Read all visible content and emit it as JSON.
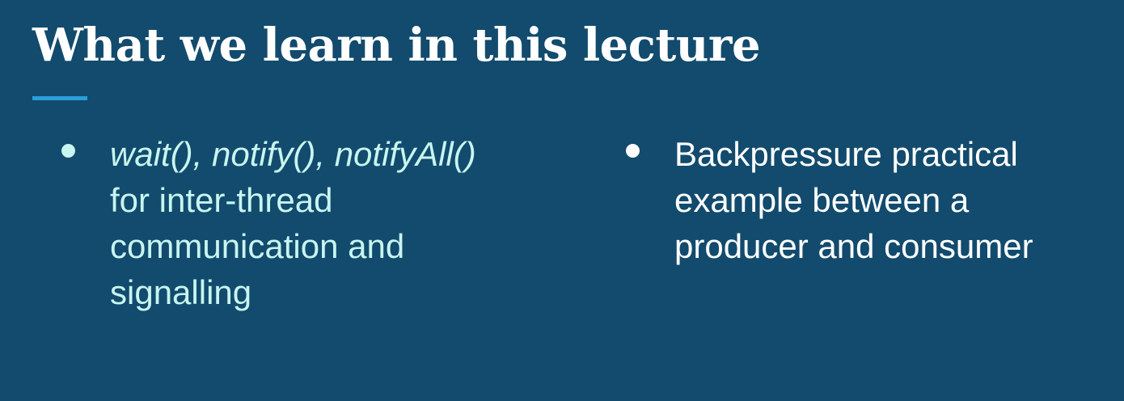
{
  "slide": {
    "title": "What we learn in this lecture",
    "accent_color": "#2a9fd8",
    "background_color": "#124b6d",
    "left_bullet": {
      "line1": "wait(), notify(), notifyAll()",
      "line2": "for inter-thread",
      "line3": "communication and",
      "line4": "signalling",
      "text_color": "#c8f5f0"
    },
    "right_bullet": {
      "line1": "Backpressure practical",
      "line2": "example between a",
      "line3": "producer and consumer",
      "text_color": "#ffffff"
    }
  }
}
